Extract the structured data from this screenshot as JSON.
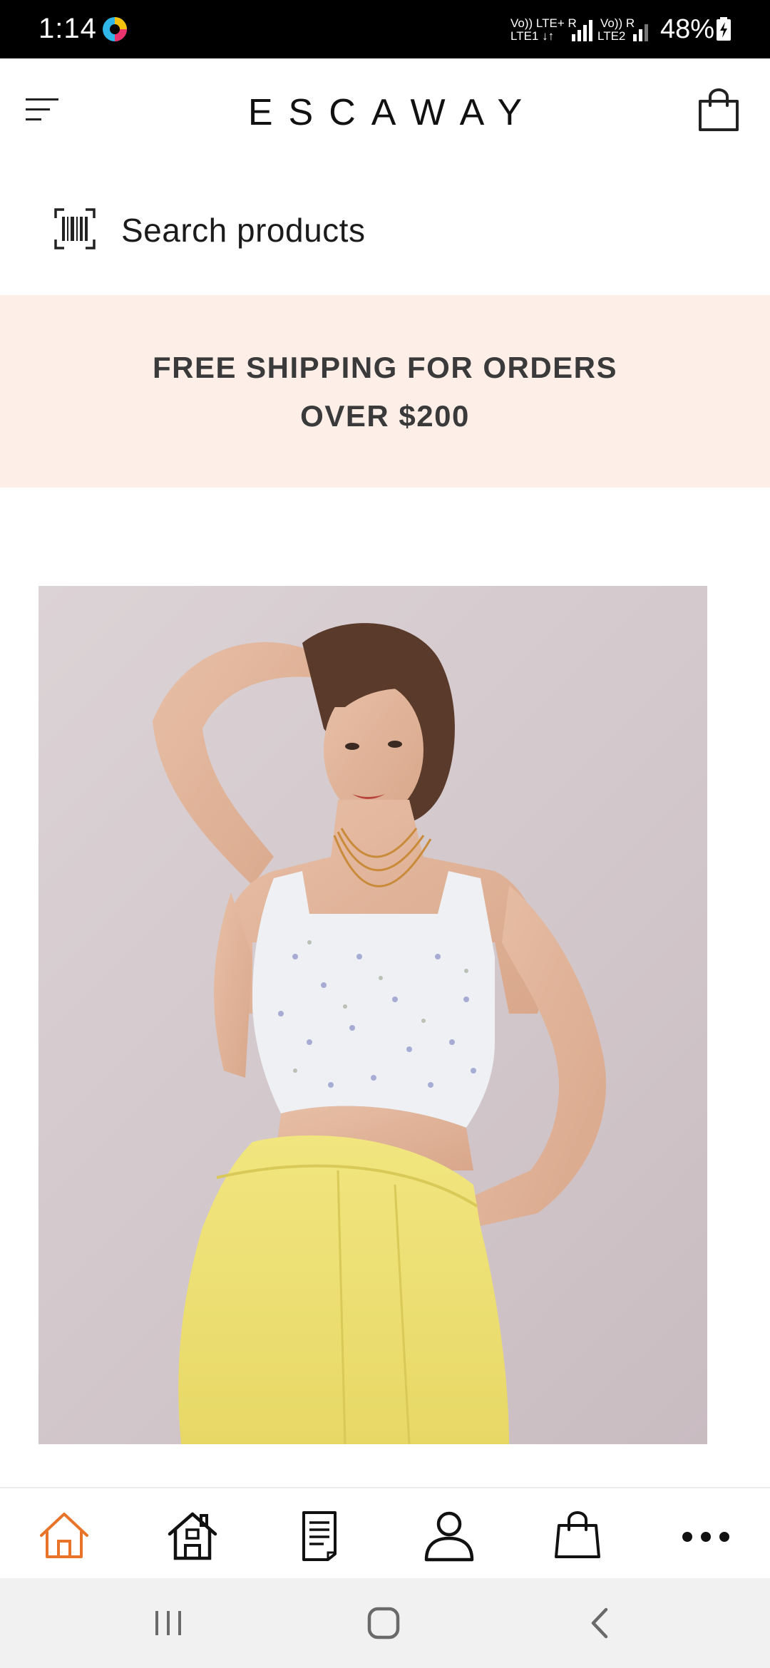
{
  "status_bar": {
    "time": "1:14",
    "sim1_top": "Vo)) LTE+ R",
    "sim1_bottom": "LTE1 ↓↑",
    "sim2_top": "Vo)) R",
    "sim2_bottom": "LTE2",
    "battery_percent": "48%"
  },
  "header": {
    "brand": "ESCAWAY",
    "menu_icon": "hamburger-menu-icon",
    "cart_icon": "shopping-bag-icon"
  },
  "search": {
    "placeholder": "Search products",
    "icon": "barcode-scan-icon"
  },
  "banner": {
    "line1": "FREE SHIPPING FOR ORDERS",
    "line2": "OVER $200",
    "background": "#fdeee8"
  },
  "hero": {
    "image": "model-in-floral-crop-top-and-yellow-trousers"
  },
  "bottom_nav": {
    "items": [
      {
        "icon": "home-outline-icon",
        "active": true
      },
      {
        "icon": "store-house-icon",
        "active": false
      },
      {
        "icon": "document-list-icon",
        "active": false
      },
      {
        "icon": "user-account-icon",
        "active": false
      },
      {
        "icon": "shopping-bag-icon",
        "active": false
      },
      {
        "icon": "more-dots-icon",
        "active": false
      }
    ],
    "active_color": "#e8742a"
  },
  "system_nav": {
    "recents": "recents-icon",
    "home": "home-circle-icon",
    "back": "back-icon"
  }
}
